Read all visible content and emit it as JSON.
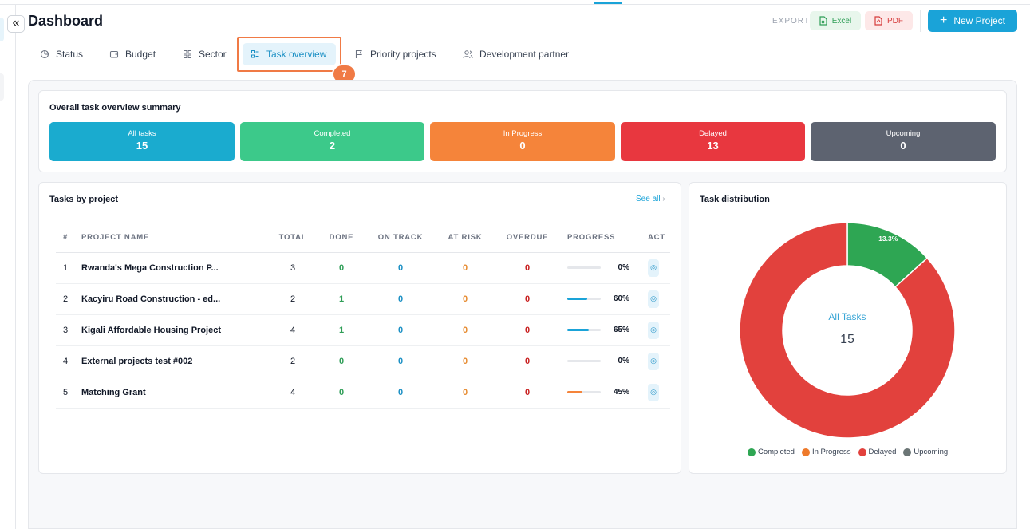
{
  "page": {
    "title": "Dashboard"
  },
  "header": {
    "collapse_icon": "«",
    "export_label": "EXPORT",
    "excel_label": "Excel",
    "pdf_label": "PDF",
    "new_project_label": "New Project"
  },
  "tabs": [
    {
      "label": "Status",
      "icon": "pie-icon"
    },
    {
      "label": "Budget",
      "icon": "wallet-icon"
    },
    {
      "label": "Sector",
      "icon": "grid-icon"
    },
    {
      "label": "Task overview",
      "icon": "list-icon",
      "active": true
    },
    {
      "label": "Priority projects",
      "icon": "flag-icon"
    },
    {
      "label": "Development partner",
      "icon": "users-icon"
    }
  ],
  "step_badge": "7",
  "summary": {
    "title": "Overall task overview summary",
    "stats": [
      {
        "label": "All tasks",
        "value": "15",
        "color": "#1aabcf"
      },
      {
        "label": "Completed",
        "value": "2",
        "color": "#3cc98a"
      },
      {
        "label": "In Progress",
        "value": "0",
        "color": "#f5843a"
      },
      {
        "label": "Delayed",
        "value": "13",
        "color": "#e8373f"
      },
      {
        "label": "Upcoming",
        "value": "0",
        "color": "#5d6370"
      }
    ]
  },
  "tasks_by_project": {
    "title": "Tasks by project",
    "see_all": "See all",
    "columns": [
      "#",
      "PROJECT NAME",
      "TOTAL",
      "DONE",
      "ON TRACK",
      "AT RISK",
      "OVERDUE",
      "PROGRESS",
      "ACT"
    ],
    "rows": [
      {
        "num": "1",
        "name": "Rwanda's Mega Construction P...",
        "total": "3",
        "done": "0",
        "on_track": "0",
        "at_risk": "0",
        "overdue": "0",
        "progress": 0,
        "progress_label": "0%",
        "bar_color": "#1aa3d8"
      },
      {
        "num": "2",
        "name": "Kacyiru Road Construction - ed...",
        "total": "2",
        "done": "1",
        "on_track": "0",
        "at_risk": "0",
        "overdue": "0",
        "progress": 60,
        "progress_label": "60%",
        "bar_color": "#1aa3d8"
      },
      {
        "num": "3",
        "name": "Kigali Affordable Housing Project",
        "total": "4",
        "done": "1",
        "on_track": "0",
        "at_risk": "0",
        "overdue": "0",
        "progress": 65,
        "progress_label": "65%",
        "bar_color": "#1aa3d8"
      },
      {
        "num": "4",
        "name": "External projects test #002",
        "total": "2",
        "done": "0",
        "on_track": "0",
        "at_risk": "0",
        "overdue": "0",
        "progress": 0,
        "progress_label": "0%",
        "bar_color": "#1aa3d8"
      },
      {
        "num": "5",
        "name": "Matching Grant",
        "total": "4",
        "done": "0",
        "on_track": "0",
        "at_risk": "0",
        "overdue": "0",
        "progress": 45,
        "progress_label": "45%",
        "bar_color": "#f5843a"
      }
    ]
  },
  "distribution": {
    "title": "Task distribution",
    "center_label": "All Tasks",
    "center_value": "15"
  },
  "chart_data": {
    "type": "pie",
    "title": "Task distribution",
    "categories": [
      "Completed",
      "In Progress",
      "Delayed",
      "Upcoming"
    ],
    "values": [
      13.3,
      0,
      86.7,
      0
    ],
    "data_labels": [
      "13.3%",
      "",
      "86.7%",
      ""
    ],
    "colors": [
      "#2ea653",
      "#ee7a2b",
      "#e2413d",
      "#6b7575"
    ],
    "legend_position": "bottom"
  }
}
